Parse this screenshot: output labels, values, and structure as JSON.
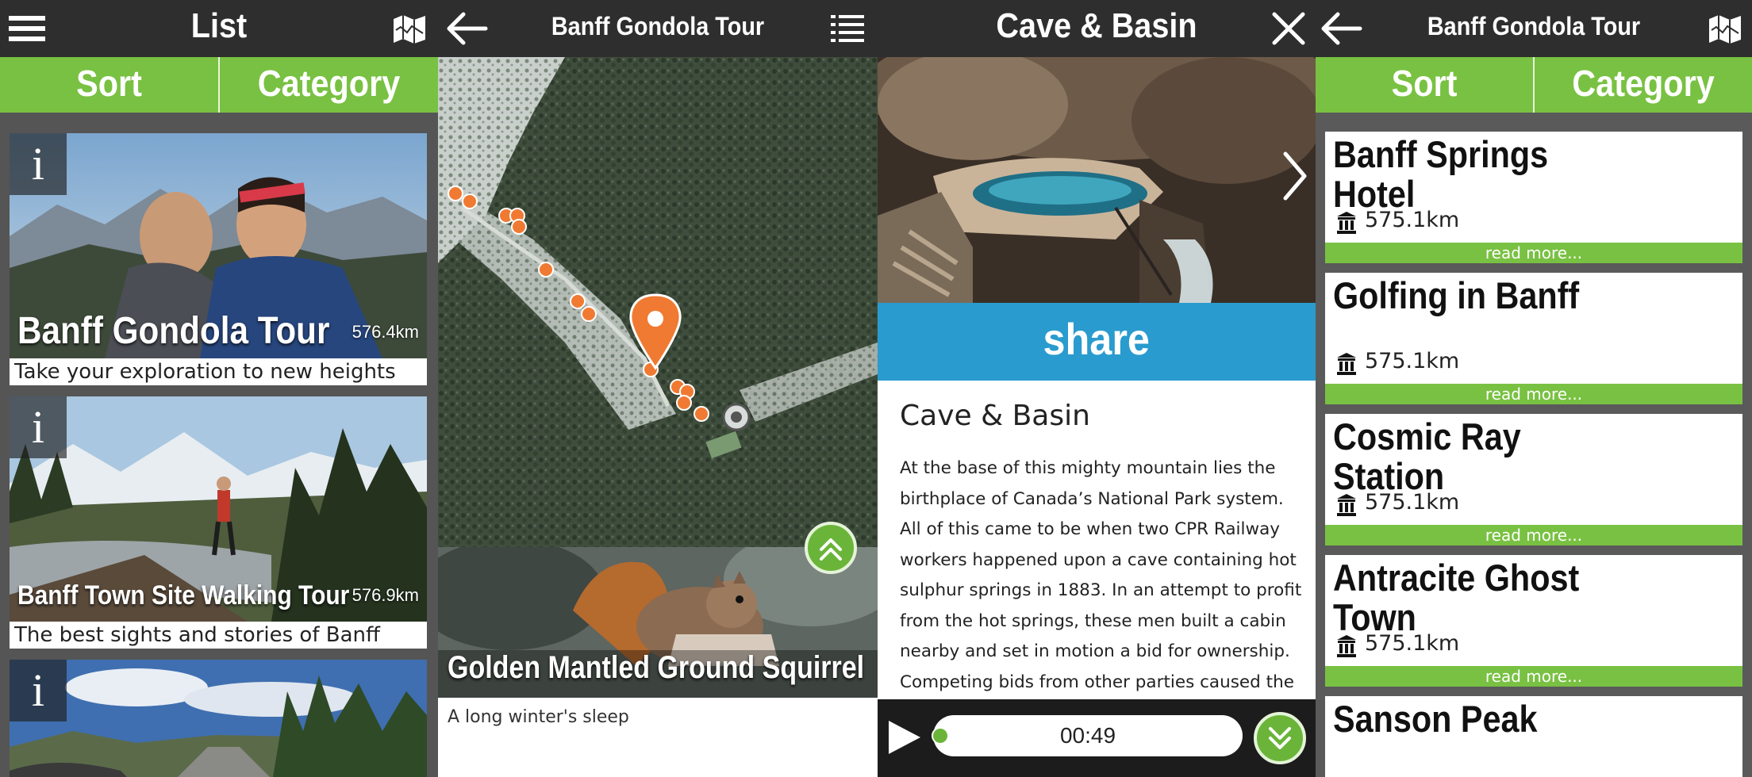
{
  "list_screen": {
    "title": "List",
    "tabs": {
      "sort": "Sort",
      "category": "Category"
    },
    "info_glyph": "i",
    "cards": [
      {
        "title": "Banff Gondola Tour",
        "distance": "576.4km",
        "subtitle": "Take your exploration to new heights"
      },
      {
        "title": "Banff Town Site Walking Tour",
        "distance": "576.9km",
        "subtitle": "The best sights and stories of Banff"
      },
      {
        "title": "",
        "distance": "",
        "subtitle": ""
      }
    ],
    "icons": {
      "menu": "hamburger-menu-icon",
      "map": "folded-map-icon",
      "info": "info-icon"
    }
  },
  "map_screen": {
    "title": "Banff Gondola Tour",
    "poi_title": "Golden Mantled Ground Squirrel",
    "poi_subtitle": "A long winter's sleep",
    "icons": {
      "back": "back-arrow-icon",
      "list": "list-icon",
      "expand": "double-chevron-up-icon",
      "pin": "map-pin-icon",
      "marker": "poi-marker-icon"
    },
    "colors": {
      "marker": "#f07a32",
      "button": "#6ab539"
    }
  },
  "detail_screen": {
    "title": "Cave & Basin",
    "share_label": "share",
    "article_title": "Cave & Basin",
    "article_lines": [
      "At the base of this mighty mountain lies the",
      "birthplace of Canada’s National Park system.",
      "All of this came to be when two CPR Railway",
      "workers happened upon a cave containing hot",
      "sulphur springs in 1883. In an attempt to profit",
      "from the hot springs, these men built a cabin",
      "nearby and set in motion a bid for ownership.",
      "Competing bids from other parties caused the"
    ],
    "audio_time": "00:49",
    "audio_progress": 0.0,
    "icons": {
      "close": "close-icon",
      "next": "chevron-right-icon",
      "play": "play-icon",
      "collapse": "double-chevron-down-icon"
    },
    "colors": {
      "share": "#2a9bce"
    }
  },
  "category_screen": {
    "title": "Banff Gondola Tour",
    "tabs": {
      "sort": "Sort",
      "category": "Category"
    },
    "read_more": "read more...",
    "items": [
      {
        "name": "Banff Springs Hotel",
        "distance": "575.1km"
      },
      {
        "name": "Golfing in Banff",
        "distance": "575.1km"
      },
      {
        "name": "Cosmic Ray Station",
        "distance": "575.1km"
      },
      {
        "name": "Antracite Ghost Town",
        "distance": "575.1km"
      },
      {
        "name": "Sanson Peak",
        "distance": ""
      }
    ],
    "icons": {
      "back": "back-arrow-icon",
      "map": "folded-map-icon",
      "category": "landmark-icon"
    },
    "colors": {
      "accent": "#79c142"
    }
  }
}
